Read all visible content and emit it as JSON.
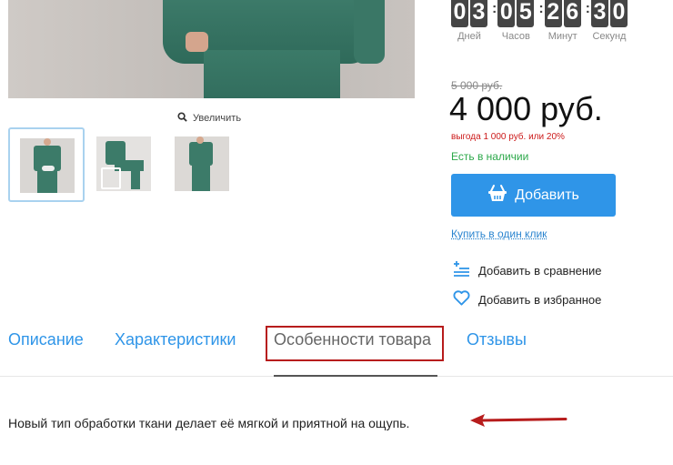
{
  "timer": {
    "groups": [
      {
        "digits": [
          "0",
          "3"
        ],
        "label": "Дней"
      },
      {
        "digits": [
          "0",
          "5"
        ],
        "label": "Часов"
      },
      {
        "digits": [
          "2",
          "6"
        ],
        "label": "Минут"
      },
      {
        "digits": [
          "3",
          "0"
        ],
        "label": "Секунд"
      }
    ],
    "separator": ":"
  },
  "gallery": {
    "zoom_label": "Увеличить"
  },
  "product": {
    "old_price": "5 000 руб.",
    "price": "4 000 руб.",
    "saving": "выгода 1 000 руб. или 20%",
    "stock": "Есть в наличии",
    "add_label": "Добавить",
    "one_click_label": "Купить в один клик",
    "compare_label": "Добавить в сравнение",
    "favorite_label": "Добавить в избранное"
  },
  "tabs": {
    "items": [
      {
        "label": "Описание"
      },
      {
        "label": "Характеристики"
      },
      {
        "label": "Особенности товара"
      },
      {
        "label": "Отзывы"
      }
    ],
    "active_index": 2
  },
  "content": {
    "text": "Новый тип обработки ткани делает её мягкой и приятной на ощупь."
  },
  "colors": {
    "accent": "#2f95e8",
    "saving": "#cc1a1a",
    "stock": "#2ca84a",
    "annotation": "#b71c1c"
  }
}
